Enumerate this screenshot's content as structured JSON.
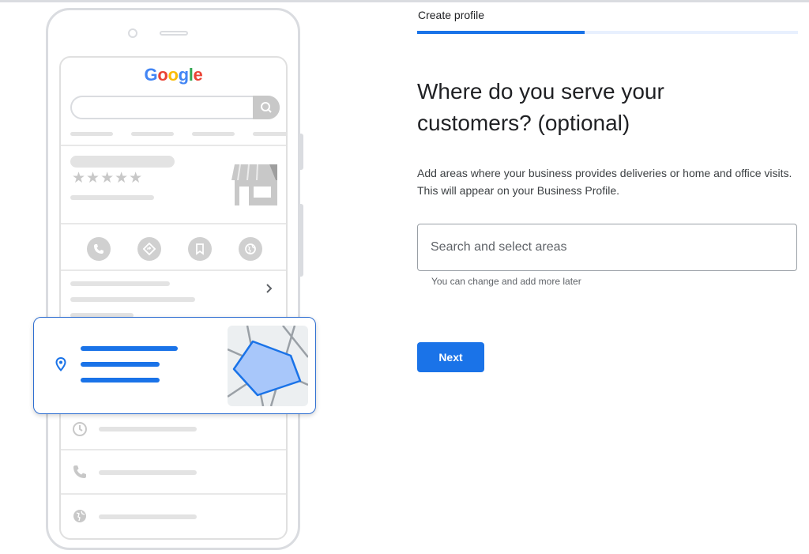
{
  "header": {
    "step_label": "Create profile",
    "progress_fraction": 0.44
  },
  "main": {
    "heading": "Where do you serve your customers? (optional)",
    "description": "Add areas where your business provides deliveries or home and office visits. This will appear on your Business Profile.",
    "search": {
      "placeholder": "Search and select areas",
      "value": "",
      "helper_text": "You can change and add more later"
    },
    "next_label": "Next"
  },
  "illustration": {
    "brand_logo_text": "Google",
    "rating_stars": "★★★★★",
    "action_icons": [
      "phone-icon",
      "directions-icon",
      "bookmark-icon",
      "globe-icon"
    ],
    "info_icons": [
      "clock-icon",
      "phone-icon",
      "globe-icon"
    ]
  },
  "colors": {
    "accent": "#1a73e8",
    "progress_track": "#e8f0fe",
    "illustration_gray": "#dadce0",
    "map_area_fill": "#a8c7fa",
    "google_blue": "#4285F4",
    "google_red": "#EA4335",
    "google_yellow": "#FBBC05",
    "google_green": "#34A853"
  }
}
